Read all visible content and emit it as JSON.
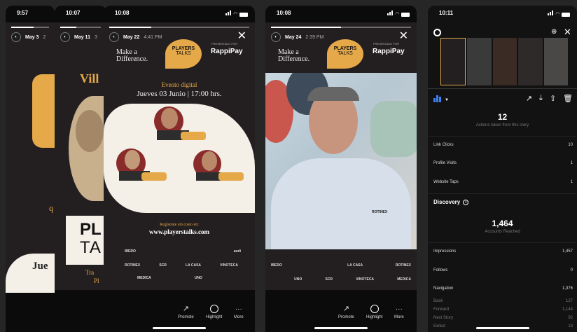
{
  "screens": [
    {
      "time": "9:57",
      "date": "May 3",
      "date_extra": "2",
      "headline": "Jue",
      "side_text": "q"
    },
    {
      "time": "10:07",
      "date": "May 11",
      "date_extra": "3",
      "headline_top": "Vill",
      "brand_1": "PL",
      "brand_2": "TA",
      "bottom_1": "Tra",
      "bottom_2": "Pl"
    },
    {
      "time": "10:08",
      "date": "May 22",
      "time_posted": "4:41 PM",
      "tagline_1": "Make a",
      "tagline_2": "Difference.",
      "badge_1": "PLAYERS",
      "badge_2": "TALKS",
      "presented_by": "PRESENTADO POR",
      "sponsor": "RappiPay",
      "event": "Evento digital",
      "event_date": "Jueves 03 Junio | 17:00 hrs.",
      "register_1": "Regístrate sin costo en:",
      "register_2": "www.playerstalks.com",
      "logos_row_1": [
        "IBERO",
        "",
        "",
        "audi"
      ],
      "logos_row_2": [
        "ROTINEX",
        "SCR",
        "LA CASA",
        "VINOTECA"
      ],
      "logos_row_3": [
        "MEDICA",
        "",
        "UNO",
        ""
      ]
    },
    {
      "time": "10:08",
      "date": "May 24",
      "time_posted": "2:39 PM",
      "tagline_1": "Make a",
      "tagline_2": "Difference.",
      "badge_1": "PLAYERS",
      "badge_2": "TALKS",
      "presented_by": "PRESENTADO POR",
      "sponsor": "RappiPay",
      "shirt_logo": "ROTINEX",
      "logos_row_1": [
        "IBERO",
        "",
        "LA CASA",
        "ROTINEX"
      ],
      "logos_row_2": [
        "",
        "UNO",
        "SCR",
        "VINOTECA",
        "MEDICA"
      ]
    },
    {
      "time": "10:11",
      "actions_count": "12",
      "actions_caption": "Actions taken from this story",
      "actions": [
        {
          "label": "Link Clicks",
          "value": "10"
        },
        {
          "label": "Profile Visits",
          "value": "1"
        },
        {
          "label": "Website Taps",
          "value": "1"
        }
      ],
      "discovery_label": "Discovery",
      "accounts_reached": "1,464",
      "accounts_caption": "Accounts Reached",
      "discovery": [
        {
          "label": "Impressions",
          "value": "1,457"
        },
        {
          "label": "Follows",
          "value": "0"
        },
        {
          "label": "Navigation",
          "value": "1,376"
        }
      ],
      "navigation": [
        {
          "label": "Back",
          "value": "127"
        },
        {
          "label": "Forward",
          "value": "1,144"
        },
        {
          "label": "Next Story",
          "value": "92"
        },
        {
          "label": "Exited",
          "value": "13"
        }
      ]
    }
  ],
  "bottom_actions": {
    "promote": "Promote",
    "highlight": "Highlight",
    "more": "More"
  },
  "colors": {
    "gold": "#e5a94a",
    "dark": "#231f20",
    "blue": "#3b82f6"
  }
}
